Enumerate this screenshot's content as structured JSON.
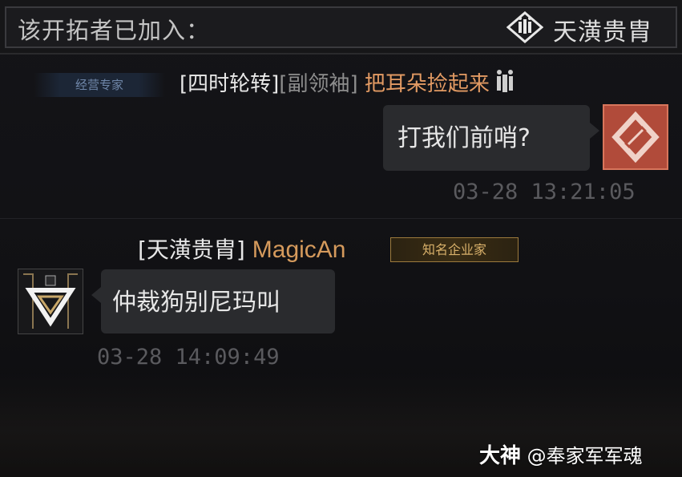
{
  "header": {
    "title": "该开拓者已加入：",
    "guild_name": "天潢贵胄"
  },
  "messages": [
    {
      "title_badge": "经营专家",
      "guild_tag": "[四时轮转]",
      "rank_tag": "[副领袖]",
      "sender": "把耳朵捡起来",
      "text": "打我们前哨?",
      "time": "03-28 13:21:05"
    },
    {
      "guild_tag": "[天潢贵胄]",
      "sender": "MagicAn",
      "title_badge": "知名企业家",
      "text": "仲裁狗别尼玛叫",
      "time": "03-28 14:09:49"
    }
  ],
  "watermark": {
    "logo": "大神",
    "handle": "@奉家军军魂"
  },
  "colors": {
    "sender_orange": "#e29a63",
    "sender_gold": "#d59a5c",
    "badge_blue": "#6f86a8",
    "badge_gold": "#d8b06a"
  }
}
